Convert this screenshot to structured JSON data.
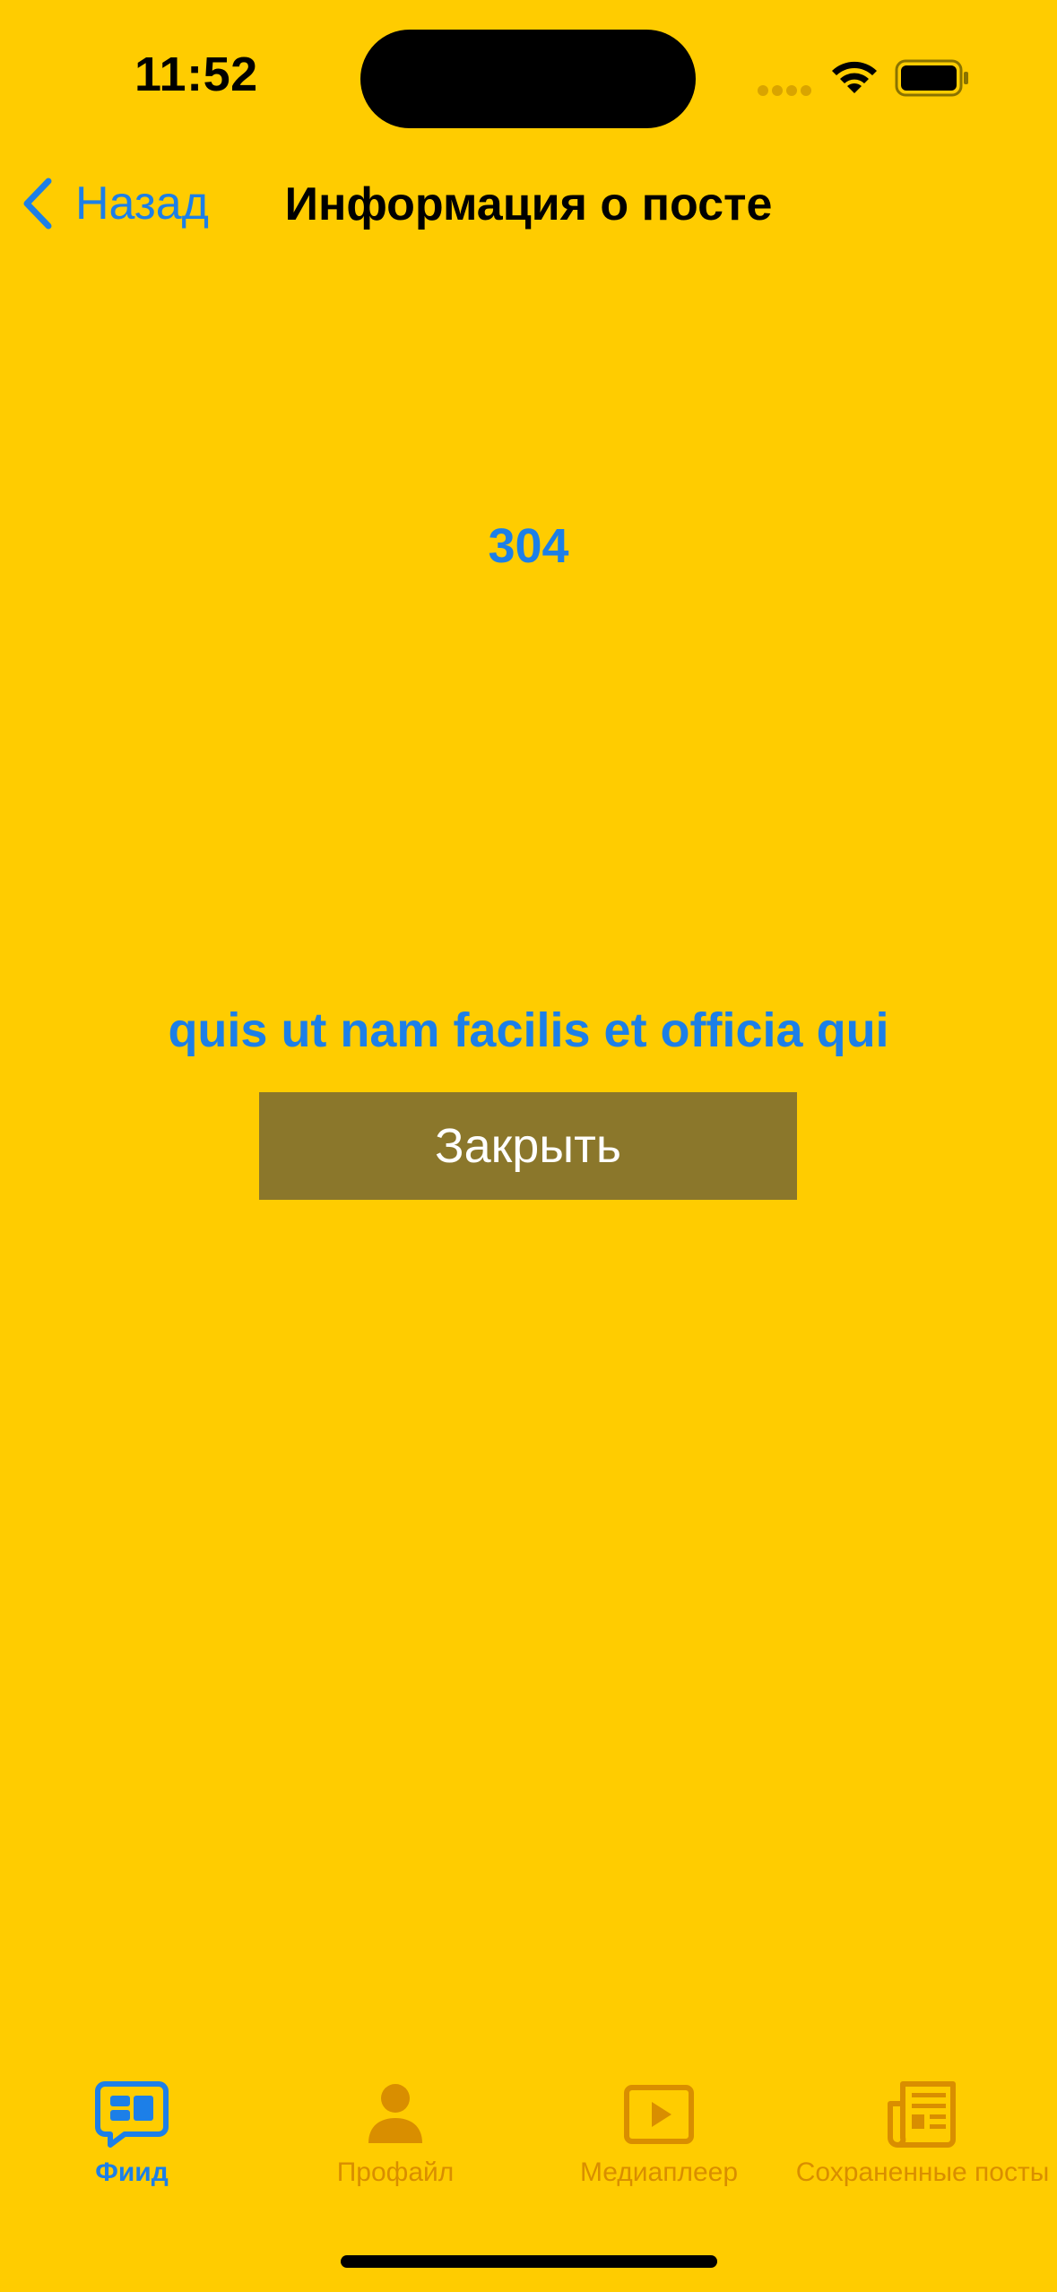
{
  "status_bar": {
    "time": "11:52"
  },
  "nav": {
    "back_label": "Назад",
    "title": "Информация о посте"
  },
  "post": {
    "number": "304",
    "title": "quis ut nam facilis et officia qui"
  },
  "actions": {
    "close_label": "Закрыть"
  },
  "tab_bar": {
    "tabs": [
      {
        "label": "Фиид",
        "icon": "feed-icon",
        "active": true
      },
      {
        "label": "Профайл",
        "icon": "person-icon",
        "active": false
      },
      {
        "label": "Медиаплеер",
        "icon": "play-icon",
        "active": false
      },
      {
        "label": "Сохраненные посты",
        "icon": "newspaper-icon",
        "active": false
      }
    ]
  },
  "colors": {
    "background": "#FFCC00",
    "accent": "#1C7FE8",
    "button": "#8B772B",
    "inactive_tab": "#D98E00"
  }
}
